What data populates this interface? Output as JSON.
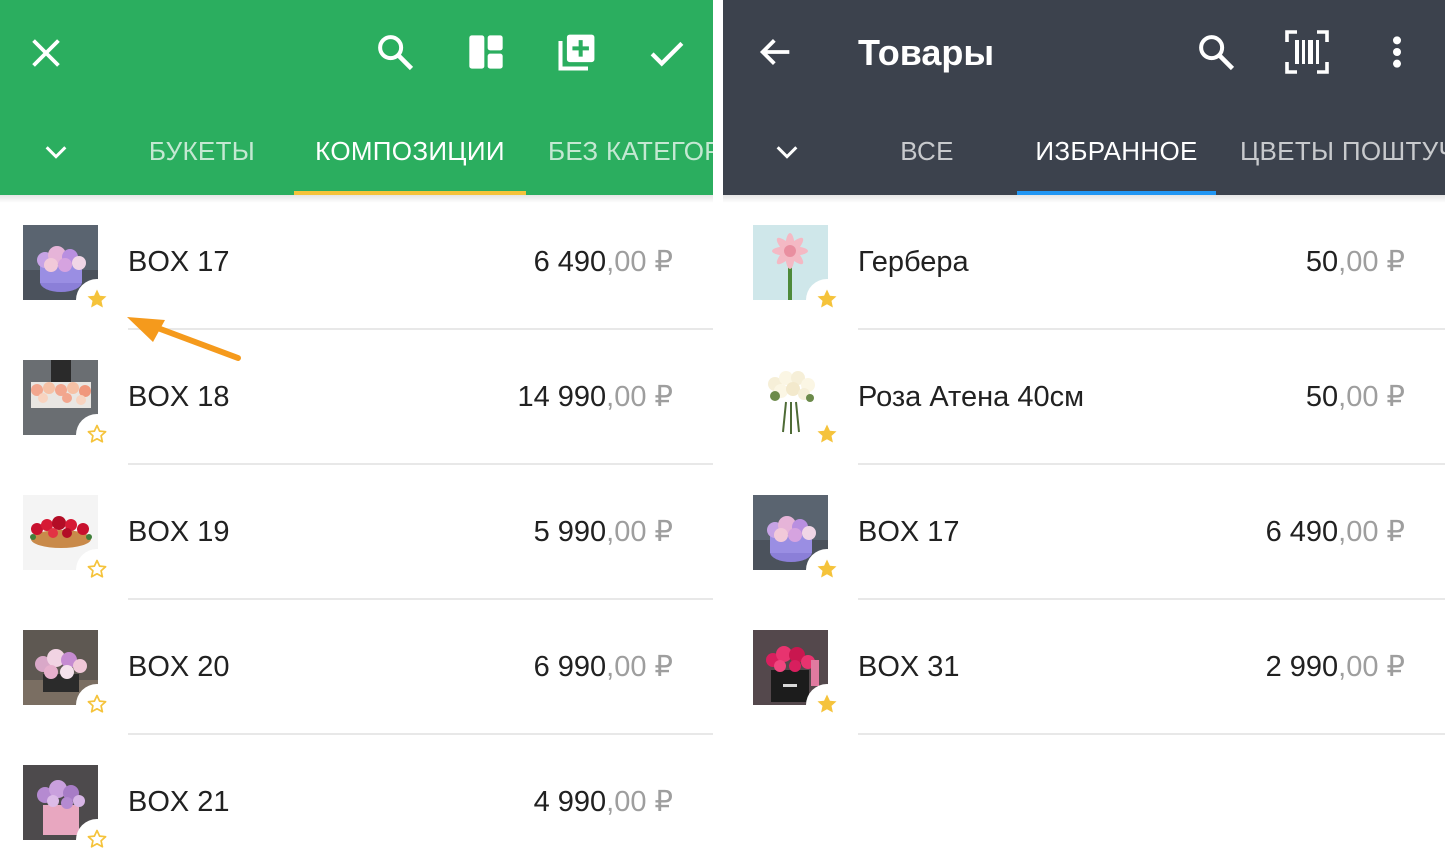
{
  "left": {
    "toolbar": {
      "close_icon": "close-icon",
      "search_icon": "search-icon",
      "layout_icon": "layout-icon",
      "add_icon": "library-add-icon",
      "check_icon": "check-icon"
    },
    "tabs": [
      "БУКЕТЫ",
      "КОМПОЗИЦИИ",
      "БЕЗ КАТЕГОР"
    ],
    "active_tab": 1,
    "accent": "#2bae5f",
    "indicator_color": "#f5c33b",
    "items": [
      {
        "name": "BOX 17",
        "price_int": "6 490",
        "price_frac": ",00 ₽",
        "favorite": true
      },
      {
        "name": "BOX 18",
        "price_int": "14 990",
        "price_frac": ",00 ₽",
        "favorite": false
      },
      {
        "name": "BOX 19",
        "price_int": "5 990",
        "price_frac": ",00 ₽",
        "favorite": false
      },
      {
        "name": "BOX 20",
        "price_int": "6 990",
        "price_frac": ",00 ₽",
        "favorite": false
      },
      {
        "name": "BOX 21",
        "price_int": "4 990",
        "price_frac": ",00 ₽",
        "favorite": false
      }
    ]
  },
  "right": {
    "title": "Товары",
    "toolbar": {
      "back_icon": "arrow-back-icon",
      "search_icon": "search-icon",
      "barcode_icon": "barcode-scan-icon",
      "menu_icon": "more-vert-icon"
    },
    "tabs": [
      "ВСЕ",
      "ИЗБРАННОЕ",
      "ЦВЕТЫ ПОШТУЧ"
    ],
    "active_tab": 1,
    "accent": "#3c424d",
    "indicator_color": "#2196f3",
    "items": [
      {
        "name": "Гербера",
        "price_int": "50",
        "price_frac": ",00 ₽",
        "favorite": true
      },
      {
        "name": "Роза Атена 40см",
        "price_int": "50",
        "price_frac": ",00 ₽",
        "favorite": true
      },
      {
        "name": "BOX 17",
        "price_int": "6 490",
        "price_frac": ",00 ₽",
        "favorite": true
      },
      {
        "name": "BOX 31",
        "price_int": "2 990",
        "price_frac": ",00 ₽",
        "favorite": true
      }
    ]
  },
  "colors": {
    "star": "#f5c33b",
    "annotation_arrow": "#f59a1c"
  }
}
